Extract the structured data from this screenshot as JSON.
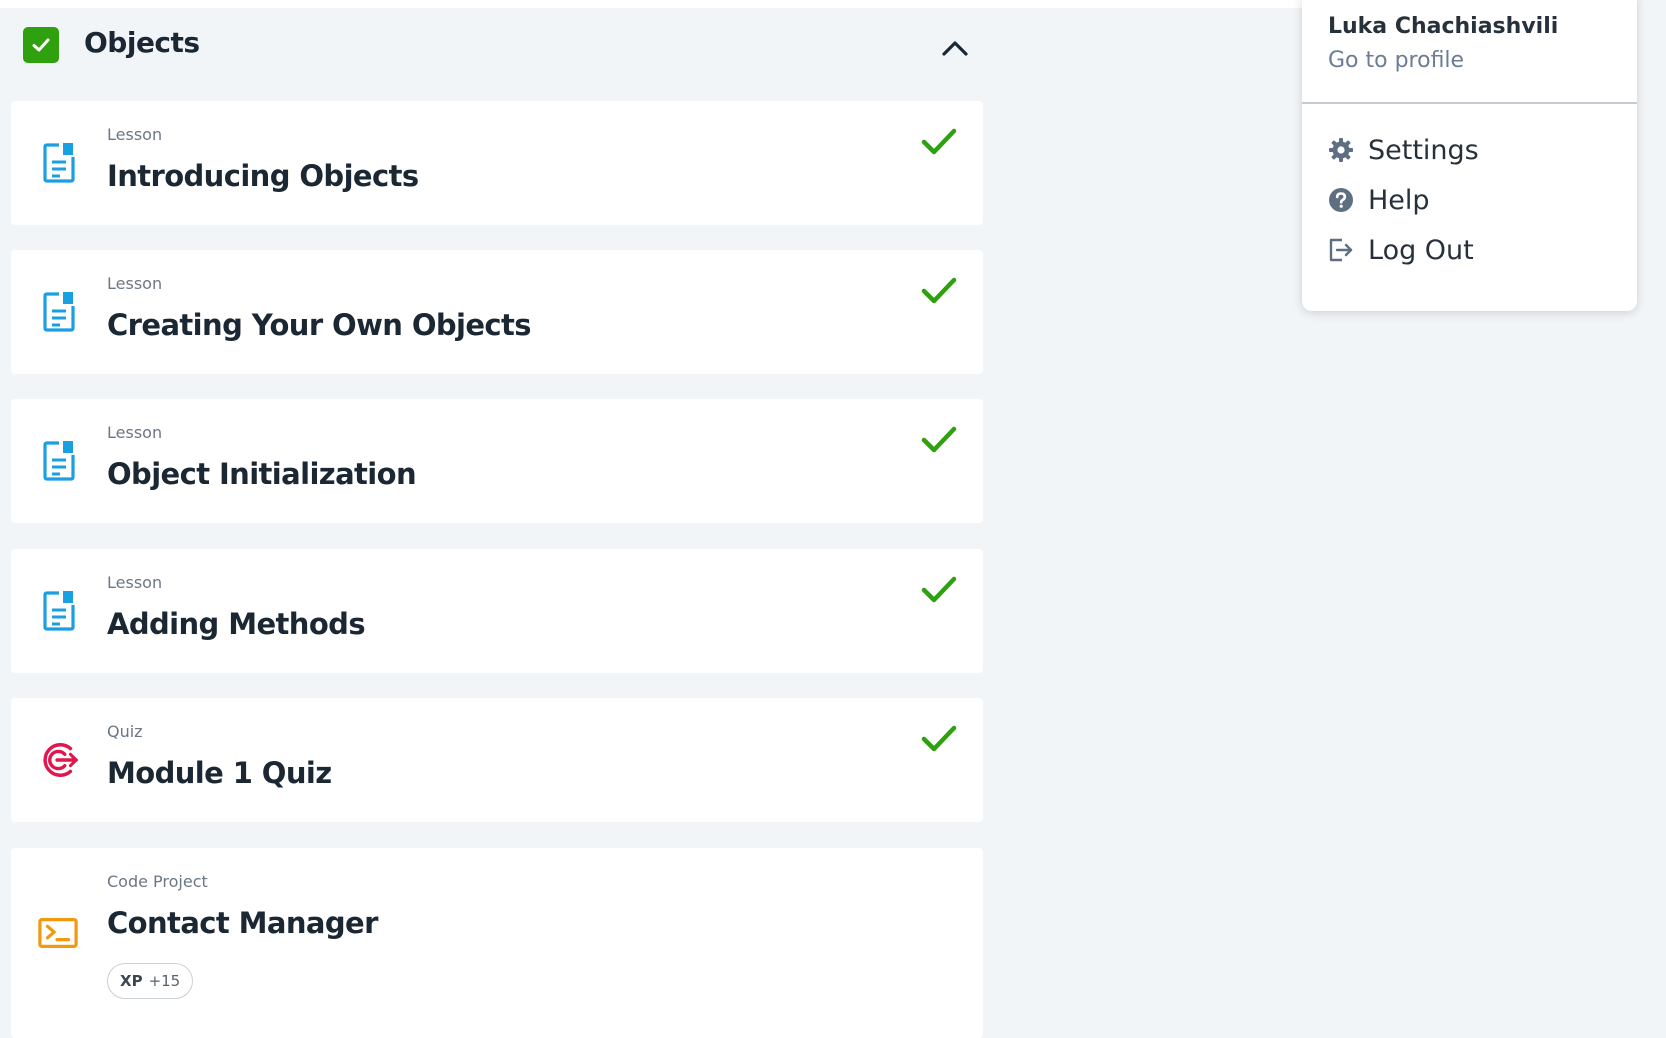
{
  "module": {
    "title": "Objects",
    "completed": true
  },
  "items": [
    {
      "type": "Lesson",
      "title": "Introducing Objects",
      "icon": "lesson-doc-icon",
      "completed": true
    },
    {
      "type": "Lesson",
      "title": "Creating Your Own Objects",
      "icon": "lesson-doc-icon",
      "completed": true
    },
    {
      "type": "Lesson",
      "title": "Object Initialization",
      "icon": "lesson-doc-icon",
      "completed": true
    },
    {
      "type": "Lesson",
      "title": "Adding Methods",
      "icon": "lesson-doc-icon",
      "completed": true
    },
    {
      "type": "Quiz",
      "title": "Module 1 Quiz",
      "icon": "target-icon",
      "completed": true
    },
    {
      "type": "Code Project",
      "title": "Contact Manager",
      "icon": "terminal-icon",
      "completed": false,
      "xp_label": "XP",
      "xp_value": "+15"
    }
  ],
  "user_menu": {
    "name": "Luka Chachiashvili",
    "profile_link": "Go to profile",
    "items": [
      {
        "label": "Settings",
        "icon": "gear-icon"
      },
      {
        "label": "Help",
        "icon": "help-circle-icon"
      },
      {
        "label": "Log Out",
        "icon": "logout-icon"
      }
    ]
  },
  "colors": {
    "success": "#2fa00e",
    "lesson_icon": "#1a9fe0",
    "quiz_icon": "#e0174f",
    "project_icon": "#f29a0f",
    "background": "#f2f5f7"
  }
}
